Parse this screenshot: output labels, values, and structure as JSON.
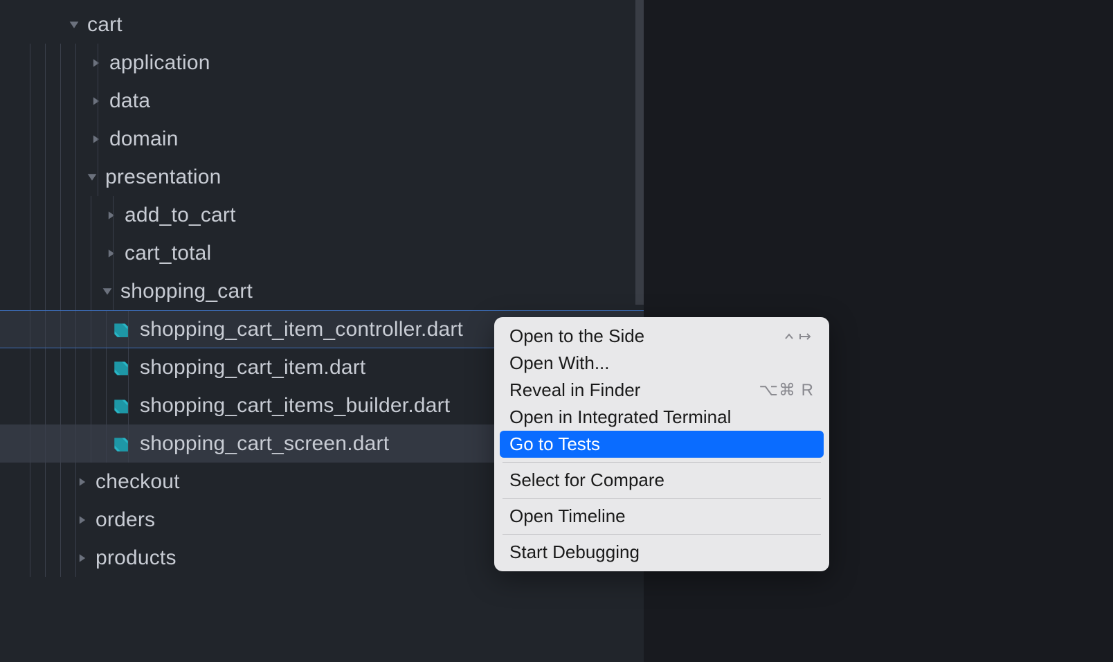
{
  "tree": {
    "cart": "cart",
    "application": "application",
    "data": "data",
    "domain": "domain",
    "presentation": "presentation",
    "add_to_cart": "add_to_cart",
    "cart_total": "cart_total",
    "shopping_cart": "shopping_cart",
    "file1": "shopping_cart_item_controller.dart",
    "file2": "shopping_cart_item.dart",
    "file3": "shopping_cart_items_builder.dart",
    "file4": "shopping_cart_screen.dart",
    "checkout": "checkout",
    "orders": "orders",
    "products": "products"
  },
  "menu": {
    "open_side": "Open to the Side",
    "open_with": "Open With...",
    "reveal": "Reveal in Finder",
    "reveal_shortcut": "⌥⌘ R",
    "terminal": "Open in Integrated Terminal",
    "go_tests": "Go to Tests",
    "select_compare": "Select for Compare",
    "timeline": "Open Timeline",
    "debug": "Start Debugging"
  }
}
